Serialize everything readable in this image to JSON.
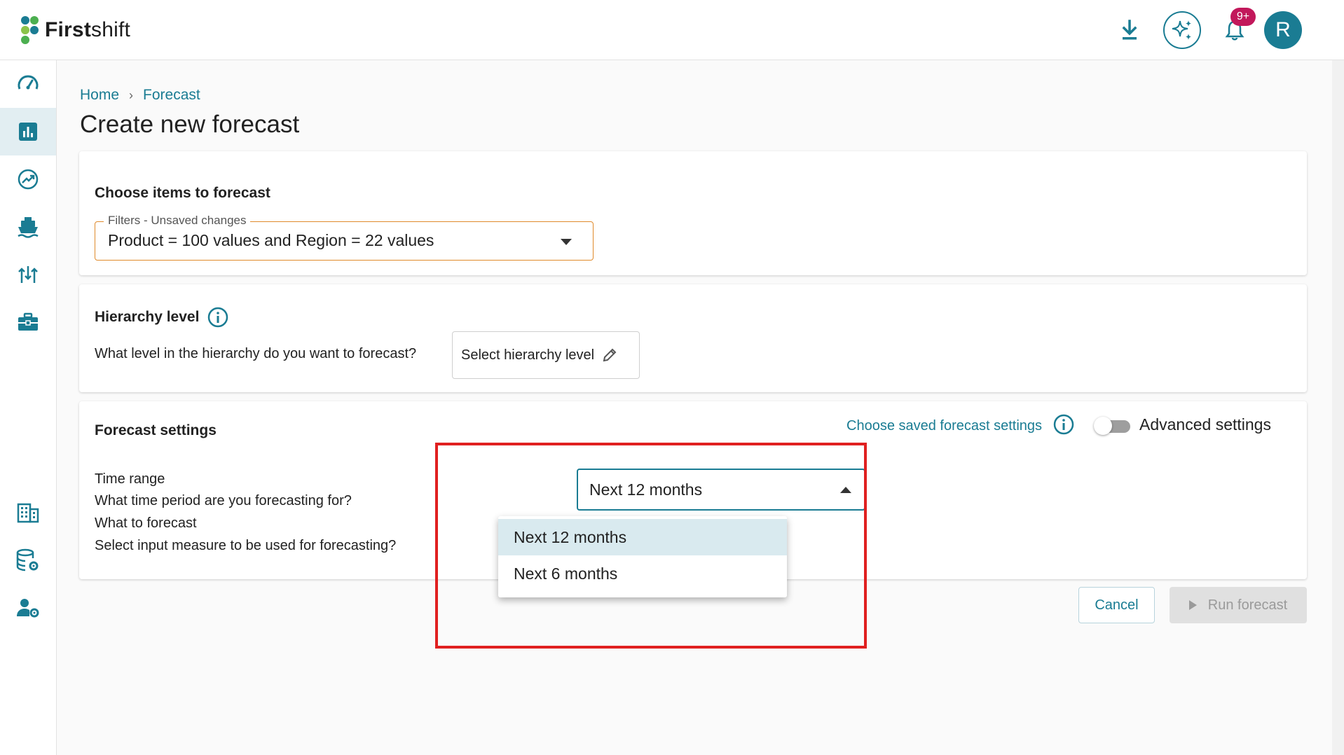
{
  "app": {
    "brand_bold": "First",
    "brand_light": "shift"
  },
  "topbar": {
    "notification_badge": "9+",
    "avatar_initial": "R",
    "icons": [
      "download-icon",
      "sparkle-icon",
      "bell-icon"
    ]
  },
  "sidebar": {
    "items": [
      {
        "icon": "dashboard-gauge-icon",
        "active": false
      },
      {
        "icon": "bar-chart-icon",
        "active": true
      },
      {
        "icon": "trending-up-icon",
        "active": false
      },
      {
        "icon": "ship-icon",
        "active": false
      },
      {
        "icon": "flow-arrows-icon",
        "active": false
      },
      {
        "icon": "briefcase-icon",
        "active": false
      },
      {
        "icon": "building-icon",
        "active": false
      },
      {
        "icon": "database-settings-icon",
        "active": false
      },
      {
        "icon": "user-settings-icon",
        "active": false
      }
    ]
  },
  "breadcrumb": {
    "home": "Home",
    "current": "Forecast",
    "separator": "›"
  },
  "page": {
    "title": "Create new forecast"
  },
  "items_card": {
    "title": "Choose items to forecast",
    "filter_legend": "Filters - Unsaved changes",
    "filter_value": "Product = 100 values and Region = 22 values"
  },
  "hierarchy_card": {
    "title": "Hierarchy level",
    "question": "What level in the hierarchy do you want to forecast?",
    "button_label": "Select hierarchy level"
  },
  "settings_card": {
    "title": "Forecast settings",
    "saved_settings_link": "Choose saved forecast settings",
    "advanced_label": "Advanced settings",
    "advanced_enabled": false,
    "time_range_label": "Time range",
    "time_range_question": "What time period are you forecasting for?",
    "what_label": "What to forecast",
    "what_question": "Select input measure to be used for forecasting?",
    "time_range_selected": "Next 12 months",
    "time_range_options": [
      "Next 12 months",
      "Next 6 months"
    ]
  },
  "actions": {
    "cancel": "Cancel",
    "run": "Run forecast"
  },
  "colors": {
    "accent": "#1a7c93",
    "filter_border": "#e08a2b",
    "highlight": "#e02020",
    "badge": "#c2185b"
  }
}
